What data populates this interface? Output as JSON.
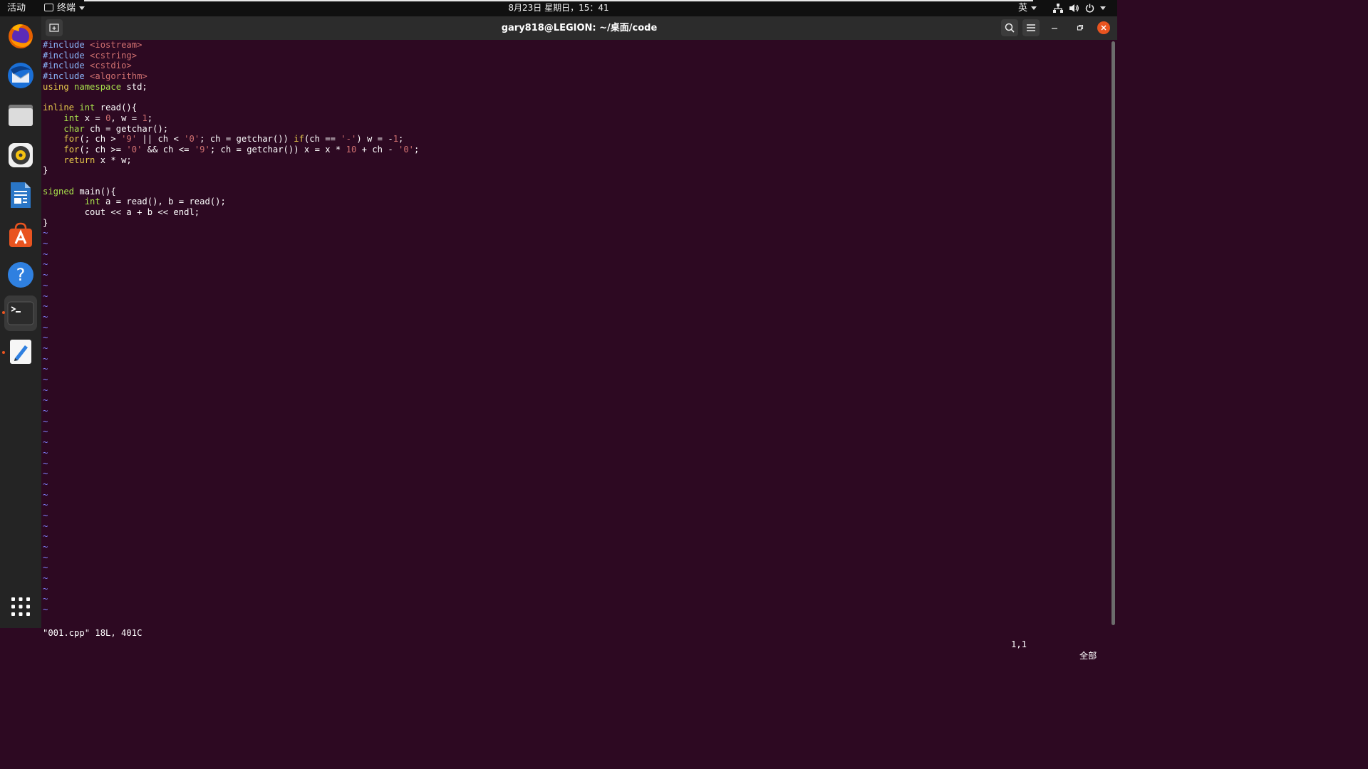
{
  "topbar": {
    "activities": "活动",
    "app_menu": "终端",
    "clock": "8月23日 星期日，15：41",
    "input_method": "英"
  },
  "window": {
    "title": "gary818@LEGION: ~/桌面/code"
  },
  "dock": {
    "items": [
      "firefox-icon",
      "thunderbird-icon",
      "files-icon",
      "rhythmbox-icon",
      "libreoffice-writer-icon",
      "app-store-icon",
      "help-icon",
      "terminal-icon",
      "text-editor-icon"
    ],
    "show_apps": "show-applications-icon"
  },
  "editor": {
    "lines": [
      [
        {
          "c": "p",
          "t": "#include"
        },
        {
          "c": "c",
          "t": " "
        },
        {
          "c": "s",
          "t": "<iostream>"
        }
      ],
      [
        {
          "c": "p",
          "t": "#include"
        },
        {
          "c": "c",
          "t": " "
        },
        {
          "c": "s",
          "t": "<cstring>"
        }
      ],
      [
        {
          "c": "p",
          "t": "#include"
        },
        {
          "c": "c",
          "t": " "
        },
        {
          "c": "s",
          "t": "<cstdio>"
        }
      ],
      [
        {
          "c": "p",
          "t": "#include"
        },
        {
          "c": "c",
          "t": " "
        },
        {
          "c": "s",
          "t": "<algorithm>"
        }
      ],
      [
        {
          "c": "k",
          "t": "using"
        },
        {
          "c": "c",
          "t": " "
        },
        {
          "c": "t",
          "t": "namespace"
        },
        {
          "c": "c",
          "t": " std;"
        }
      ],
      [
        {
          "c": "c",
          "t": ""
        }
      ],
      [
        {
          "c": "k",
          "t": "inline"
        },
        {
          "c": "c",
          "t": " "
        },
        {
          "c": "t",
          "t": "int"
        },
        {
          "c": "c",
          "t": " read(){"
        }
      ],
      [
        {
          "c": "c",
          "t": "    "
        },
        {
          "c": "t",
          "t": "int"
        },
        {
          "c": "c",
          "t": " x = "
        },
        {
          "c": "s",
          "t": "0"
        },
        {
          "c": "c",
          "t": ", w = "
        },
        {
          "c": "s",
          "t": "1"
        },
        {
          "c": "c",
          "t": ";"
        }
      ],
      [
        {
          "c": "c",
          "t": "    "
        },
        {
          "c": "t",
          "t": "char"
        },
        {
          "c": "c",
          "t": " ch = getchar();"
        }
      ],
      [
        {
          "c": "c",
          "t": "    "
        },
        {
          "c": "k",
          "t": "for"
        },
        {
          "c": "c",
          "t": "(; ch > "
        },
        {
          "c": "s",
          "t": "'9'"
        },
        {
          "c": "c",
          "t": " || ch < "
        },
        {
          "c": "s",
          "t": "'0'"
        },
        {
          "c": "c",
          "t": "; ch = getchar()) "
        },
        {
          "c": "k",
          "t": "if"
        },
        {
          "c": "c",
          "t": "(ch == "
        },
        {
          "c": "s",
          "t": "'-'"
        },
        {
          "c": "c",
          "t": ") w = -"
        },
        {
          "c": "s",
          "t": "1"
        },
        {
          "c": "c",
          "t": ";"
        }
      ],
      [
        {
          "c": "c",
          "t": "    "
        },
        {
          "c": "k",
          "t": "for"
        },
        {
          "c": "c",
          "t": "(; ch >= "
        },
        {
          "c": "s",
          "t": "'0'"
        },
        {
          "c": "c",
          "t": " && ch <= "
        },
        {
          "c": "s",
          "t": "'9'"
        },
        {
          "c": "c",
          "t": "; ch = getchar()) x = x * "
        },
        {
          "c": "s",
          "t": "10"
        },
        {
          "c": "c",
          "t": " + ch - "
        },
        {
          "c": "s",
          "t": "'0'"
        },
        {
          "c": "c",
          "t": ";"
        }
      ],
      [
        {
          "c": "c",
          "t": "    "
        },
        {
          "c": "k",
          "t": "return"
        },
        {
          "c": "c",
          "t": " x * w;"
        }
      ],
      [
        {
          "c": "c",
          "t": "}"
        }
      ],
      [
        {
          "c": "c",
          "t": ""
        }
      ],
      [
        {
          "c": "t",
          "t": "signed"
        },
        {
          "c": "c",
          "t": " main(){"
        }
      ],
      [
        {
          "c": "c",
          "t": "        "
        },
        {
          "c": "t",
          "t": "int"
        },
        {
          "c": "c",
          "t": " a = read(), b = read();"
        }
      ],
      [
        {
          "c": "c",
          "t": "        cout << a + b << endl;"
        }
      ],
      [
        {
          "c": "c",
          "t": "}"
        }
      ]
    ],
    "tilde_lines": 37,
    "tilde_char": "~",
    "status_file": "\"001.cpp\" 18L, 401C",
    "status_pos": "1,1",
    "status_scroll": "全部"
  },
  "colors": {
    "terminal_bg": "#2d0922",
    "keyword": "#e6c84b",
    "type": "#a8e04c",
    "preproc": "#8ab4f8",
    "constant": "#d07070",
    "tilde": "#8080ff",
    "close_button": "#e95420"
  }
}
